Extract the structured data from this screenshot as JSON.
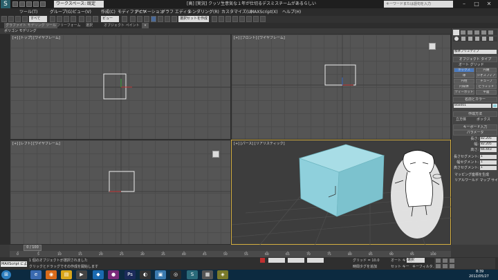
{
  "titlebar": {
    "workspace_dropdown": "ワークスペース: 既定",
    "window_title": "[高] [実況] クッソ生意気な１年が仕切るデスミスチームがあるらしい",
    "search_placeholder": "キーワードまたは語句を入力",
    "minimize": "–",
    "maximize": "□",
    "close": "✕"
  },
  "menubar": {
    "items": [
      "ツール(T)",
      "グループ(G)",
      "ビュー(V)",
      "作成(C)",
      "モディファイヤ",
      "アニメーション",
      "グラフ エディタ",
      "レンダリング(R)",
      "カスタマイズ(U)",
      "MAXScript(X)",
      "ヘルプ(H)"
    ]
  },
  "toolbar": {
    "selection_filter": "すべて",
    "reference_coord": "ビュー",
    "named_selection": "選択セットを作成"
  },
  "ribbon": {
    "tabs": [
      "グラファイト モデリング ツール",
      "フリーフォーム",
      "選択",
      "オブジェクト ペイント"
    ],
    "subtitle": "ポリゴン モデリング"
  },
  "viewports": {
    "top": "[+] [トップ] [ワイヤフレーム]",
    "front": "[+] [フロント] [ワイヤフレーム]",
    "left": "[+] [レフト] [ワイヤフレーム]",
    "perspective": "[+] [パース] [リアリスティック]"
  },
  "command_panel": {
    "category_dropdown": "標準プリミティブ",
    "object_type_header": "オブジェクト タイプ",
    "autogrid": "オート グリッド",
    "buttons": [
      "ボックス",
      "円錐",
      "球",
      "ジオスフィア",
      "円柱",
      "チューブ",
      "円環体",
      "ピラミッド",
      "ティーポット",
      "平面"
    ],
    "name_color_header": "名前とカラー",
    "object_name": "Box001",
    "creation_method_header": "作成方法",
    "method_cube": "立方体",
    "method_box": "ボックス",
    "keyboard_entry_header": "キーボード入力",
    "parameters_header": "パラメータ",
    "param_labels": [
      "長さ:",
      "幅:",
      "高さ:",
      "長さセグメント:",
      "幅セグメント:",
      "高さセグメント:"
    ],
    "param_values": [
      "82.205",
      "82.205",
      "66.443",
      "1",
      "1",
      "1"
    ],
    "gen_mapping": "マッピング座標を生成",
    "real_world": "リアルワールド マップ サイズ"
  },
  "timeline": {
    "frame": "0 / 100",
    "ticks": [
      "0",
      "5",
      "10",
      "15",
      "20",
      "25",
      "30",
      "35",
      "40",
      "45",
      "50",
      "55",
      "60",
      "65",
      "70",
      "75",
      "80",
      "85",
      "90",
      "95",
      "100"
    ]
  },
  "status": {
    "maxscript": "MAXScript にようこ",
    "line1": "1 個のオブジェクトが選択されました",
    "line2": "クリックとドラッグでその作成を開始します",
    "grid": "グリッド = 10.0",
    "autokey": "オート キー",
    "selected": "選択",
    "setkey": "セット キー",
    "keyfilter": "キーフィルタ...",
    "add_time_tag": "時間タグを追加"
  },
  "taskbar": {
    "time": "8:39",
    "date": "2012/05/27"
  },
  "colors": {
    "box_fill": "#8fd0dc",
    "active_border": "#d6b040",
    "selection_white": "#e8e8e8"
  }
}
